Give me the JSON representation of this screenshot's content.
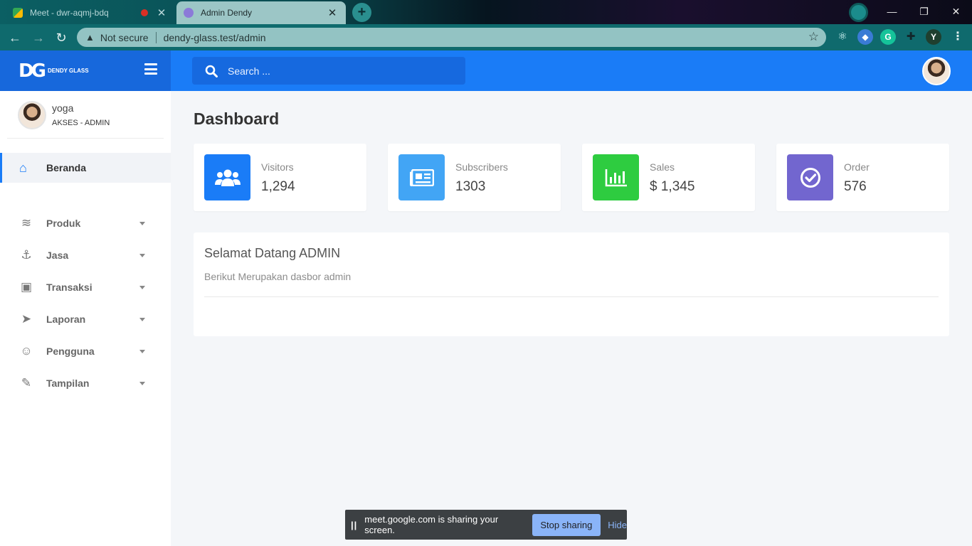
{
  "browser": {
    "tabs": [
      {
        "label": "Meet - dwr-aqmj-bdq",
        "active": false
      },
      {
        "label": "Admin Dendy",
        "active": true
      }
    ],
    "security_label": "Not secure",
    "url": "dendy-glass.test/admin",
    "profile_initial": "Y"
  },
  "brand": {
    "logo": "DG",
    "name": "DENDY GLASS"
  },
  "search": {
    "placeholder": "Search ..."
  },
  "user": {
    "name": "yoga",
    "role": "AKSES - ADMIN"
  },
  "sidebar": {
    "active": {
      "label": "Beranda",
      "icon": "home-icon"
    },
    "items": [
      {
        "label": "Produk",
        "icon": "layers-icon"
      },
      {
        "label": "Jasa",
        "icon": "anchor-icon"
      },
      {
        "label": "Transaksi",
        "icon": "money-icon"
      },
      {
        "label": "Laporan",
        "icon": "paper-plane-icon"
      },
      {
        "label": "Pengguna",
        "icon": "user-icon"
      },
      {
        "label": "Tampilan",
        "icon": "brush-icon"
      }
    ]
  },
  "page": {
    "title": "Dashboard"
  },
  "cards": [
    {
      "label": "Visitors",
      "value": "1,294",
      "color": "#1a7cf7",
      "icon": "users-icon"
    },
    {
      "label": "Subscribers",
      "value": "1303",
      "color": "#42a5f5",
      "icon": "newspaper-icon"
    },
    {
      "label": "Sales",
      "value": "$ 1,345",
      "color": "#2ecc40",
      "icon": "chart-icon"
    },
    {
      "label": "Order",
      "value": "576",
      "color": "#7266cf",
      "icon": "check-circle-icon"
    }
  ],
  "welcome": {
    "title": "Selamat Datang ADMIN",
    "subtitle": "Berikut Merupakan dasbor admin"
  },
  "screen_share": {
    "message": "meet.google.com is sharing your screen.",
    "stop_label": "Stop sharing",
    "hide_label": "Hide"
  }
}
